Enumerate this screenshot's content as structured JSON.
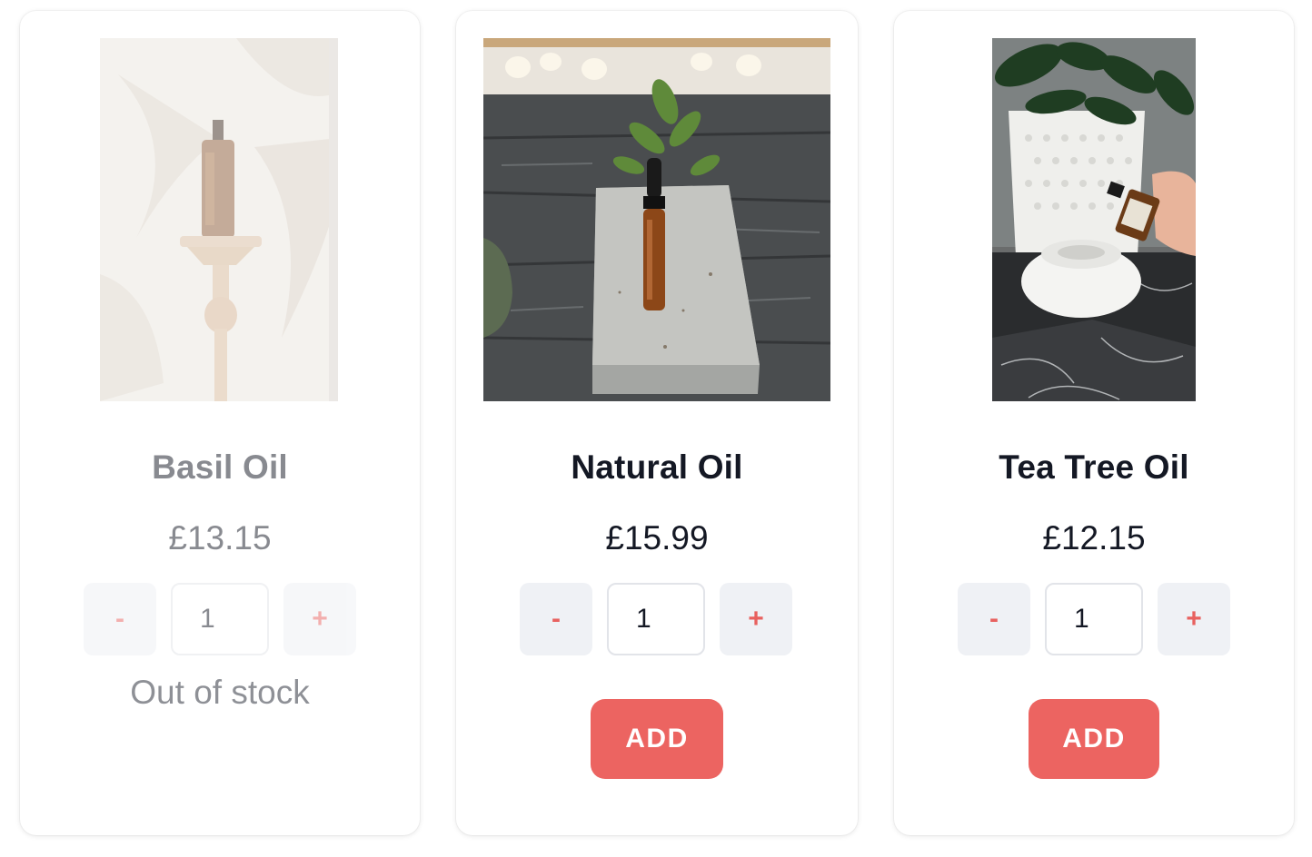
{
  "products": [
    {
      "name": "Basil Oil",
      "price": "£13.15",
      "quantity": "1",
      "decrement_label": "-",
      "increment_label": "+",
      "stock_status": "Out of stock",
      "available": false
    },
    {
      "name": "Natural Oil",
      "price": "£15.99",
      "quantity": "1",
      "decrement_label": "-",
      "increment_label": "+",
      "add_label": "ADD",
      "available": true
    },
    {
      "name": "Tea Tree Oil",
      "price": "£12.15",
      "quantity": "1",
      "decrement_label": "-",
      "increment_label": "+",
      "add_label": "ADD",
      "available": true
    }
  ],
  "colors": {
    "accent": "#ec6461",
    "text": "#141824",
    "button_bg": "#eff1f5"
  }
}
